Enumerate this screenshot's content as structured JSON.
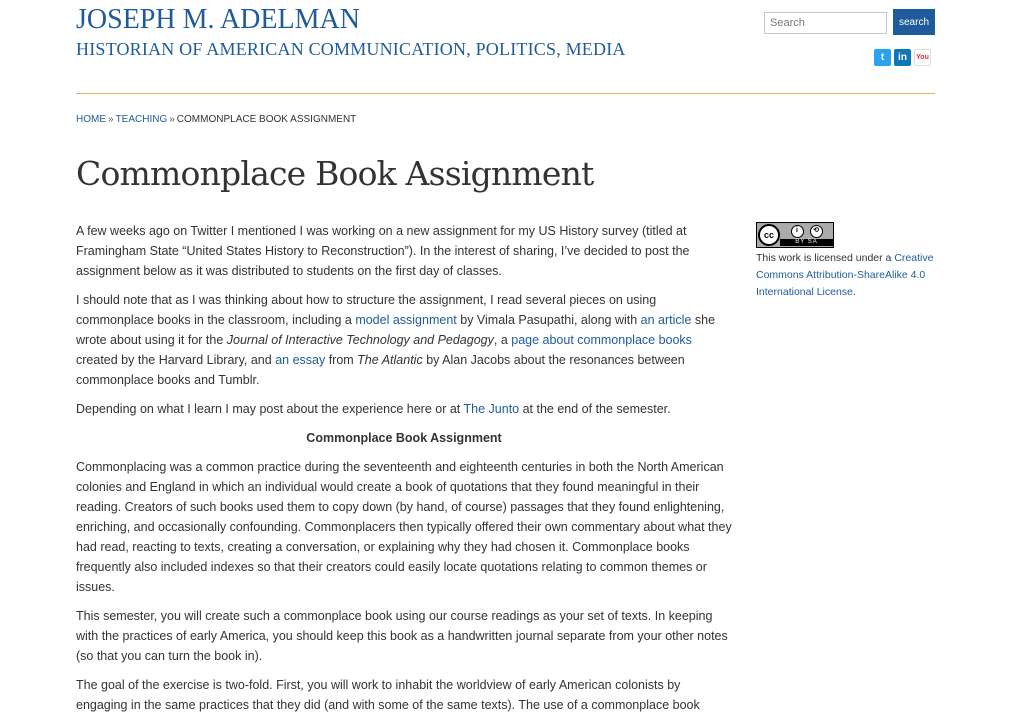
{
  "header": {
    "site_name": "JOSEPH M. ADELMAN",
    "tagline": "HISTORIAN OF AMERICAN COMMUNICATION, POLITICS, MEDIA",
    "search_placeholder": "Search",
    "search_button": "search",
    "social_icons": [
      "twitter-icon",
      "linkedin-icon",
      "youtube-icon"
    ]
  },
  "breadcrumb": {
    "home": "HOME",
    "sep": "»",
    "teaching": "TEACHING",
    "current": "COMMONPLACE BOOK ASSIGNMENT"
  },
  "page_title": "Commonplace Book Assignment",
  "content": {
    "p1": "A few weeks ago on Twitter I mentioned I was working on a new assignment for my US History survey (titled at Framingham State “United States History to Reconstruction”). In the interest of sharing, I’ve decided to post the assignment below as it was distributed to students on the first day of classes.",
    "p2": {
      "t1": "I should note that as I was thinking about how to structure the assignment, I read several pieces on using commonplace books in the classroom, including a ",
      "link1": "model assignment",
      "t2": " by Vimala Pasupathi, along with ",
      "link2": "an article",
      "t3": " she wrote about using it for the ",
      "em1": "Journal of Interactive Technology and Pedagogy",
      "t4": ", a ",
      "link3": "page about commonplace books",
      "t5": " created by the Harvard Library, and ",
      "link4": "an essay",
      "t6": " from ",
      "em2": "The Atlantic",
      "t7": " by Alan Jacobs about the resonances between commonplace books and Tumblr."
    },
    "p3": {
      "t1": "Depending on what I learn I may post about the experience here or at ",
      "link1": "The Junto",
      "t2": " at the end of the semester."
    },
    "section_heading": "Commonplace Book Assignment",
    "p4": "Commonplacing was a common practice during the seventeenth and eighteenth centuries in both the North American colonies and England in which an individual would create a book of quotations that they found meaningful in their reading. Creators of such books used them to copy down (by hand, of course) passages that they found enlightening, enriching, and occasionally confounding. Commonplacers then typically offered their own commentary about what they had read, reacting to texts, creating a conversation, or explaining why they had chosen it. Commonplace books frequently also included indexes so that their creators could easily locate quotations relating to common themes or issues.",
    "p5": "This semester, you will create such a commonplace book using our course readings as your set of texts. In keeping with the practices of early America, you should keep this book as a handwritten journal separate from your other notes (so that you can turn the book in).",
    "p6": "The goal of the exercise is two-fold. First, you will work to inhabit the worldview of early American colonists by engaging in the same practices that they did (and with some of the same texts). The use of a commonplace book"
  },
  "sidebar": {
    "badge_cc": "cc",
    "badge_text": "BY SA",
    "license_prefix": "This work is licensed under a ",
    "license_link": "Creative Commons Attribution-ShareAlike 4.0 International License",
    "license_suffix": "."
  },
  "colors": {
    "link": "#1f5b9a",
    "rule": "#d8b56b",
    "text": "#333333"
  }
}
